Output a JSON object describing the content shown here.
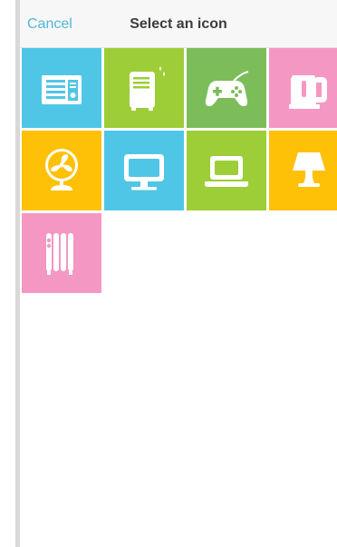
{
  "header": {
    "cancel_label": "Cancel",
    "title": "Select an icon"
  },
  "icons": [
    {
      "name": "air-conditioner-icon",
      "color": "#4fc6e6"
    },
    {
      "name": "dehumidifier-icon",
      "color": "#9dcd37"
    },
    {
      "name": "game-controller-icon",
      "color": "#7cbd5a"
    },
    {
      "name": "kettle-icon",
      "color": "#f497c3"
    },
    {
      "name": "fan-icon",
      "color": "#ffc107"
    },
    {
      "name": "monitor-icon",
      "color": "#4fc6e6"
    },
    {
      "name": "laptop-icon",
      "color": "#9dcd37"
    },
    {
      "name": "lamp-icon",
      "color": "#ffc107"
    },
    {
      "name": "oil-radiator-heater-icon",
      "color": "#f497c3"
    }
  ]
}
